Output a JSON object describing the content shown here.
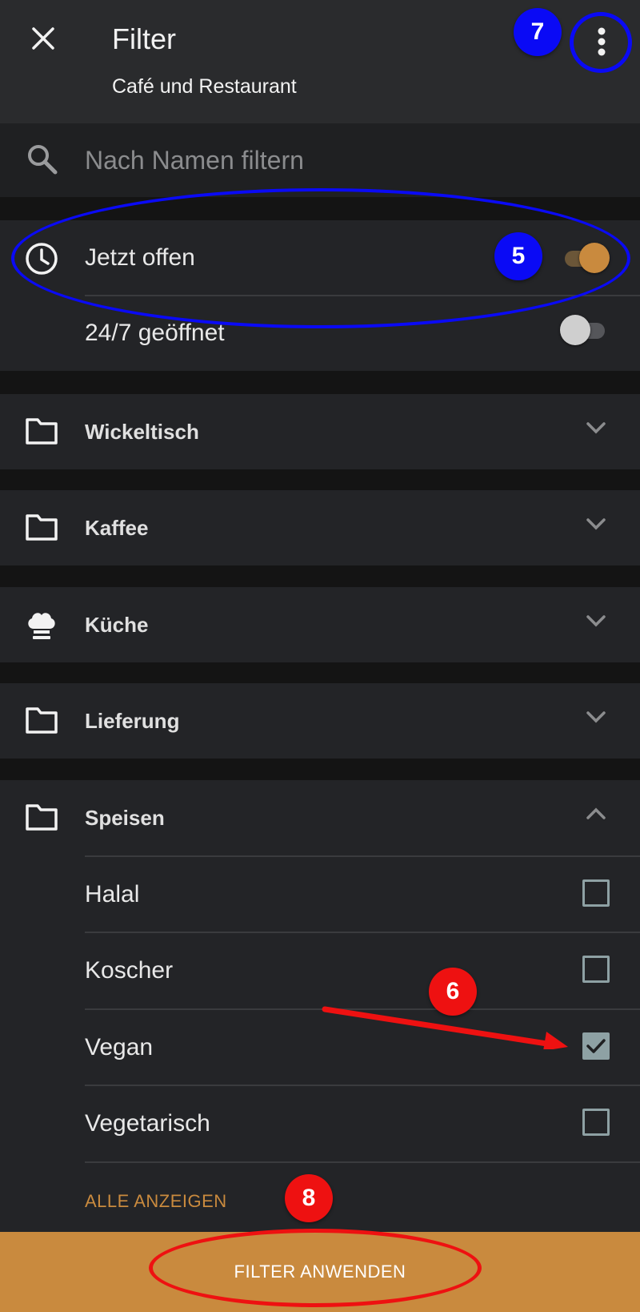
{
  "header": {
    "title": "Filter",
    "subtitle": "Café und Restaurant"
  },
  "search": {
    "placeholder": "Nach Namen filtern"
  },
  "toggles": [
    {
      "label": "Jetzt offen",
      "on": true
    },
    {
      "label": "24/7 geöffnet",
      "on": false
    }
  ],
  "categories": [
    {
      "label": "Wickeltisch",
      "icon": "folder-icon"
    },
    {
      "label": "Kaffee",
      "icon": "folder-icon"
    },
    {
      "label": "Küche",
      "icon": "chef-hat-icon"
    },
    {
      "label": "Lieferung",
      "icon": "folder-icon"
    }
  ],
  "speisen": {
    "label": "Speisen",
    "icon": "folder-icon",
    "options": [
      {
        "label": "Halal",
        "checked": false
      },
      {
        "label": "Koscher",
        "checked": false
      },
      {
        "label": "Vegan",
        "checked": true
      },
      {
        "label": "Vegetarisch",
        "checked": false
      }
    ],
    "show_all": "ALLE ANZEIGEN"
  },
  "apply_button": "FILTER ANWENDEN",
  "annotations": {
    "badge_5": "5",
    "badge_6": "6",
    "badge_7": "7",
    "badge_8": "8"
  },
  "colors": {
    "accent": "#c98a3e",
    "annotation_blue": "#0a0af5",
    "annotation_red": "#ee1111"
  }
}
